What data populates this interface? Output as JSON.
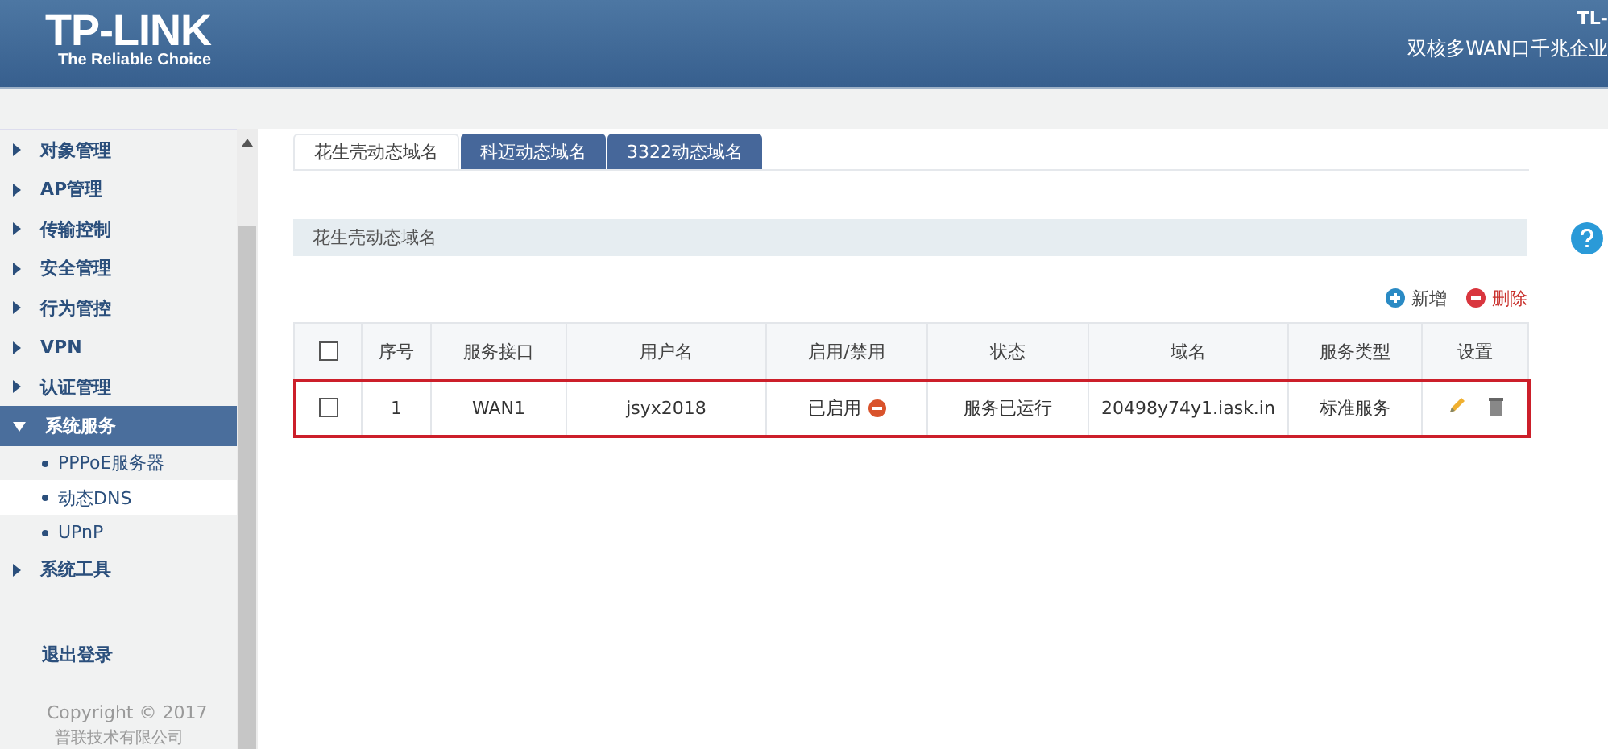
{
  "header": {
    "logo": "TP-LINK",
    "tagline": "The Reliable Choice",
    "model": "TL-",
    "product": "双核多WAN口千兆企业"
  },
  "sidebar": {
    "items": [
      {
        "label": "对象管理",
        "expanded": false
      },
      {
        "label": "AP管理",
        "expanded": false
      },
      {
        "label": "传输控制",
        "expanded": false
      },
      {
        "label": "安全管理",
        "expanded": false
      },
      {
        "label": "行为管控",
        "expanded": false
      },
      {
        "label": "VPN",
        "expanded": false
      },
      {
        "label": "认证管理",
        "expanded": false
      },
      {
        "label": "系统服务",
        "expanded": true,
        "children": [
          {
            "label": "PPPoE服务器",
            "selected": false
          },
          {
            "label": "动态DNS",
            "selected": true
          },
          {
            "label": "UPnP",
            "selected": false
          }
        ]
      },
      {
        "label": "系统工具",
        "expanded": false
      }
    ],
    "logout": "退出登录",
    "copyright": "Copyright © 2017",
    "company": "普联技术有限公司"
  },
  "tabs": [
    {
      "label": "花生壳动态域名",
      "selected": true
    },
    {
      "label": "科迈动态域名",
      "selected": false
    },
    {
      "label": "3322动态域名",
      "selected": false
    }
  ],
  "section_title": "花生壳动态域名",
  "actions": {
    "add": "新增",
    "delete": "删除"
  },
  "table": {
    "columns": [
      "序号",
      "服务接口",
      "用户名",
      "启用/禁用",
      "状态",
      "域名",
      "服务类型",
      "设置"
    ],
    "header_checked": false,
    "rows": [
      {
        "checked": false,
        "highlighted": true,
        "cells": [
          "1",
          "WAN1",
          "jsyx2018",
          "已启用",
          "服务已运行",
          "20498y74y1.iask.in",
          "标准服务"
        ]
      }
    ]
  }
}
